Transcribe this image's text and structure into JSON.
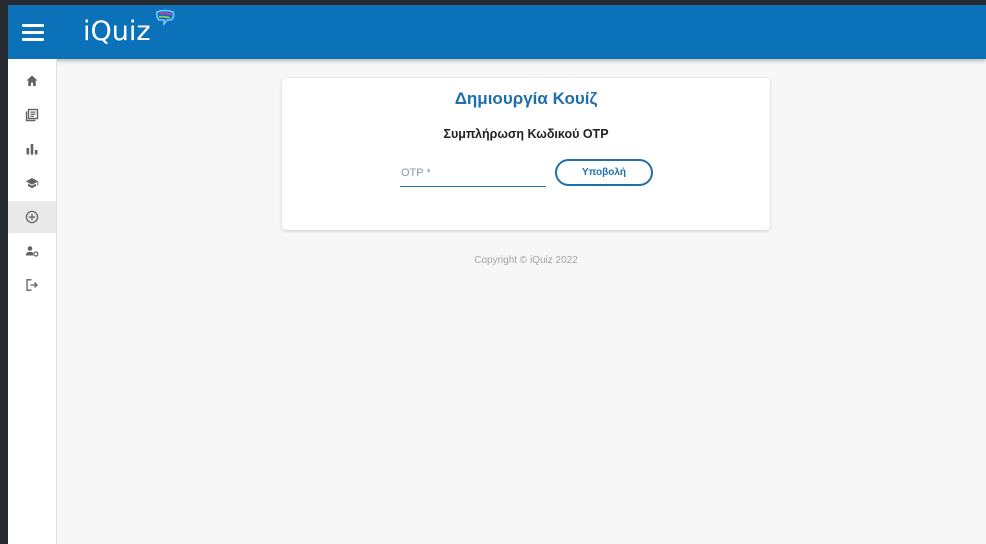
{
  "appbar": {
    "brand": "iQuiz",
    "menu_icon": "hamburger-menu-icon",
    "colors": {
      "background": "#0b72b9",
      "text": "#ffffff"
    }
  },
  "sidebar": {
    "items": [
      {
        "id": "home",
        "icon": "home-icon"
      },
      {
        "id": "quizzes",
        "icon": "library-books-icon"
      },
      {
        "id": "statistics",
        "icon": "bar-chart-icon"
      },
      {
        "id": "courses",
        "icon": "graduation-cap-icon"
      },
      {
        "id": "create-quiz",
        "icon": "add-circle-outline-icon",
        "active": true
      },
      {
        "id": "account",
        "icon": "manage-accounts-icon"
      },
      {
        "id": "logout",
        "icon": "logout-icon"
      }
    ]
  },
  "card": {
    "title": "Δημιουργία Κουίζ",
    "subtitle": "Συμπλήρωση Κωδικού OTP",
    "otp_input": {
      "value": "",
      "placeholder": "OTP *"
    },
    "submit_label": "Υποβολή",
    "colors": {
      "accent": "#1f6fab"
    }
  },
  "footer": {
    "copyright": "Copyright © iQuiz 2022"
  }
}
